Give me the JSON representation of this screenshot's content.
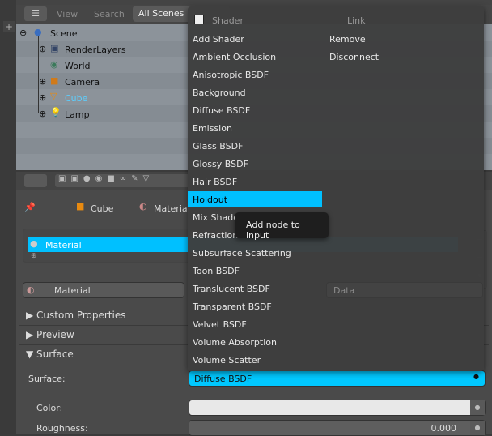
{
  "outliner": {
    "header": {
      "view": "View",
      "search": "Search",
      "display_mode": "All Scenes"
    },
    "tree": [
      {
        "label": "Scene",
        "icon": "scene-icon"
      },
      {
        "label": "RenderLayers",
        "icon": "render-layers-icon"
      },
      {
        "label": "World",
        "icon": "world-icon"
      },
      {
        "label": "Camera",
        "icon": "camera-icon"
      },
      {
        "label": "Cube",
        "icon": "mesh-icon",
        "selected": true
      },
      {
        "label": "Lamp",
        "icon": "lamp-icon"
      }
    ]
  },
  "properties": {
    "breadcrumb": {
      "object": "Cube",
      "material": "Material"
    },
    "material_slot": "Material",
    "material_name": "Material",
    "data_link": "Data",
    "panels": {
      "custom_properties": "Custom Properties",
      "preview": "Preview",
      "surface": "Surface"
    },
    "surface_label": "Surface:",
    "surface_value": "Diffuse BSDF",
    "color_label": "Color:",
    "roughness_label": "Roughness:",
    "roughness_value": "0.000",
    "accent_color": "#00c0ff"
  },
  "menu": {
    "shader_header": "Shader",
    "link_header": "Link",
    "shader_items": [
      "Add Shader",
      "Ambient Occlusion",
      "Anisotropic BSDF",
      "Background",
      "Diffuse BSDF",
      "Emission",
      "Glass BSDF",
      "Glossy BSDF",
      "Hair BSDF",
      "Holdout",
      "Mix Shader",
      "Refraction BSDF",
      "Subsurface Scattering",
      "Toon BSDF",
      "Translucent BSDF",
      "Transparent BSDF",
      "Velvet BSDF",
      "Volume Absorption",
      "Volume Scatter"
    ],
    "highlighted": "Holdout",
    "link_items": [
      "Remove",
      "Disconnect"
    ]
  },
  "tooltip": "Add node to input"
}
